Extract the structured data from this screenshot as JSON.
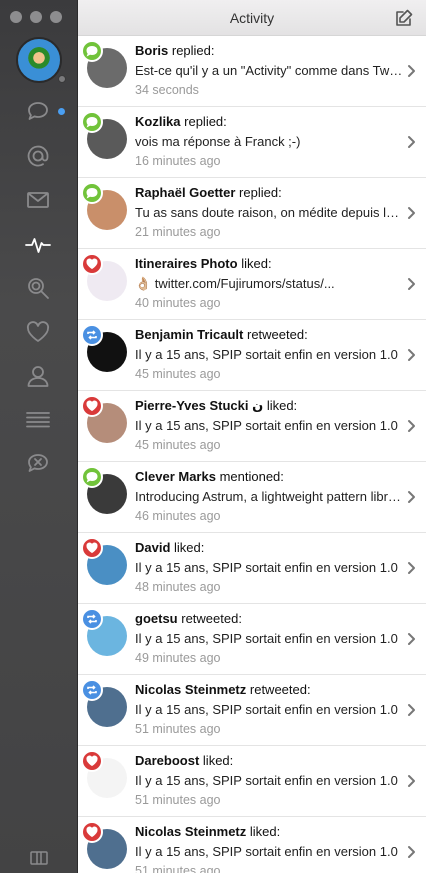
{
  "window": {
    "title": "Activity"
  },
  "sidebar": {
    "icons": [
      "profile-avatar",
      "messages-icon",
      "mentions-icon",
      "mail-icon",
      "activity-icon",
      "search-icon",
      "likes-icon",
      "profile-icon",
      "lists-icon",
      "muted-icon"
    ],
    "columns_icon": "columns-icon"
  },
  "activity": [
    {
      "user": "Boris",
      "action": "replied:",
      "text": "Est-ce qu'il y a un \"Activity\" comme dans Tweetbot?",
      "time": "34 seconds",
      "type": "reply",
      "avatar_color": "#6b6b6b"
    },
    {
      "user": "Kozlika",
      "action": "replied:",
      "text": "vois ma réponse à Franck ;-)",
      "time": "16 minutes ago",
      "type": "reply",
      "avatar_color": "#5a5a5a"
    },
    {
      "user": "Raphaël Goetter",
      "action": "replied:",
      "text": "Tu as sans doute raison, on médite depuis longtemps",
      "time": "21 minutes ago",
      "type": "reply",
      "avatar_color": "#c98f6a"
    },
    {
      "user": "Itineraires Photo",
      "action": "liked:",
      "text": "👌🏼 twitter.com/Fujirumors/status/...",
      "time": "40 minutes ago",
      "type": "like",
      "avatar_color": "#efeaf2"
    },
    {
      "user": "Benjamin Tricault",
      "action": "retweeted:",
      "text": "Il y a 15 ans, SPIP sortait enfin en version 1.0",
      "time": "45 minutes ago",
      "type": "retweet",
      "avatar_color": "#111111"
    },
    {
      "user": "Pierre-Yves Stucki ن",
      "action": "liked:",
      "text": "Il y a 15 ans, SPIP sortait enfin en version 1.0",
      "time": "45 minutes ago",
      "type": "like",
      "avatar_color": "#b58d7a"
    },
    {
      "user": "Clever Marks",
      "action": "mentioned:",
      "text": "Introducing Astrum, a lightweight pattern library",
      "time": "46 minutes ago",
      "type": "mention",
      "avatar_color": "#3a3a3a"
    },
    {
      "user": "David",
      "action": "liked:",
      "text": "Il y a 15 ans, SPIP sortait enfin en version 1.0",
      "time": "48 minutes ago",
      "type": "like",
      "avatar_color": "#4a8fc4"
    },
    {
      "user": "goetsu",
      "action": "retweeted:",
      "text": "Il y a 15 ans, SPIP sortait enfin en version 1.0",
      "time": "49 minutes ago",
      "type": "retweet",
      "avatar_color": "#6bb5e0"
    },
    {
      "user": "Nicolas Steinmetz",
      "action": "retweeted:",
      "text": "Il y a 15 ans, SPIP sortait enfin en version 1.0",
      "time": "51 minutes ago",
      "type": "retweet",
      "avatar_color": "#4f6f8f"
    },
    {
      "user": "Dareboost",
      "action": "liked:",
      "text": "Il y a 15 ans, SPIP sortait enfin en version 1.0",
      "time": "51 minutes ago",
      "type": "like",
      "avatar_color": "#f4f4f4"
    },
    {
      "user": "Nicolas Steinmetz",
      "action": "liked:",
      "text": "Il y a 15 ans, SPIP sortait enfin en version 1.0",
      "time": "51 minutes ago",
      "type": "like",
      "avatar_color": "#4f6f8f"
    }
  ]
}
